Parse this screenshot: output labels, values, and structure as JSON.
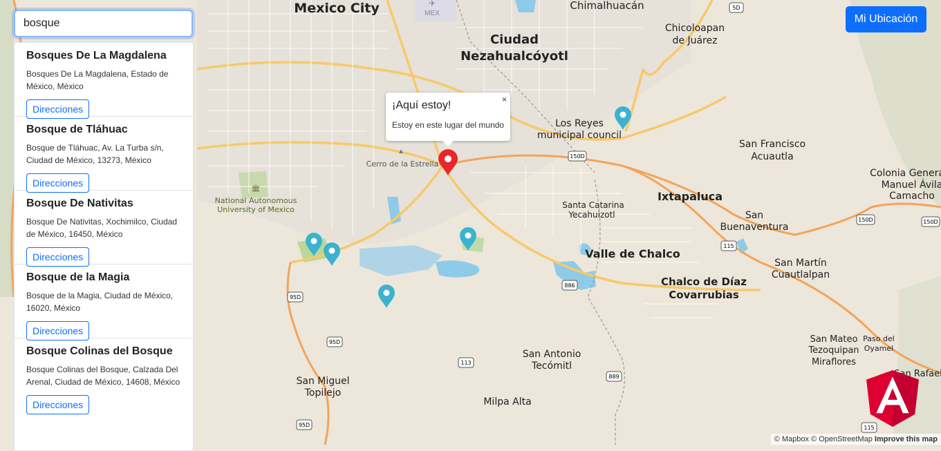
{
  "search": {
    "value": "bosque"
  },
  "results": [
    {
      "title": "Bosques De La Magdalena",
      "address_line1": "Bosques De La Magdalena, Estado de",
      "address_line2": "México, México",
      "button": "Direcciones"
    },
    {
      "title": "Bosque de Tláhuac",
      "address_line1": "Bosque de Tláhuac, Av. La Turba s/n,",
      "address_line2": "Ciudad de México, 13273, México",
      "button": "Direcciones"
    },
    {
      "title": "Bosque De Nativitas",
      "address_line1": "Bosque De Nativitas, Xochimilco, Ciudad",
      "address_line2": "de México, 16450, México",
      "button": "Direcciones"
    },
    {
      "title": "Bosque de la Magia",
      "address_line1": "Bosque de la Magia, Ciudad de México,",
      "address_line2": "16020, México",
      "button": "Direcciones"
    },
    {
      "title": "Bosque Colinas del Bosque",
      "address_line1": "Bosque Colinas del Bosque, Calzada Del",
      "address_line2": "Arenal, Ciudad de México, 14608, México",
      "button": "Direcciones"
    }
  ],
  "location_button": "Mi Ubicación",
  "popup": {
    "title": "¡Aquí estoy!",
    "text": "Estoy en este lugar del mundo",
    "close": "×"
  },
  "attribution": {
    "mapbox": "© Mapbox",
    "osm": "© OpenStreetMap",
    "improve": "Improve this map"
  },
  "map_labels": {
    "mexico_city": "Mexico City",
    "mex": "MEX",
    "chimalhuacan": "Chimalhuacán",
    "ciudad": "Ciudad",
    "nezahualcoyotl": "Nezahualcóyotl",
    "chicoloapan": "Chicoloapan",
    "de_juarez": "de Juárez",
    "los_reyes": "Los Reyes",
    "municipal_council": "municipal council",
    "san_francisco": "San Francisco",
    "acuautla": "Acuautla",
    "colonia_general": "Colonia General",
    "manuel_avila": "Manuel Ávila",
    "camacho": "Camacho",
    "cerro_estrella": "Cerro de la Estrella",
    "national_autonomous": "National Autonomous",
    "university_mexico": "University of Mexico",
    "santa_catarina": "Santa Catarina",
    "yecahuizotl": "Yecahuizotl",
    "ixtapaluca": "Ixtapaluca",
    "san": "San",
    "buenaventura": "Buenaventura",
    "valle_chalco": "Valle de Chalco",
    "san_martin": "San Martín",
    "cuautlalpan": "Cuautlalpan",
    "chalco_diaz": "Chalco de Díaz",
    "covarrubias": "Covarrubias",
    "san_antonio": "San Antonio",
    "tecomitl": "Tecómitl",
    "san_mateo": "San Mateo",
    "tezoquipan": "Tezoquipan",
    "miraflores": "Miraflores",
    "paso_del": "Paso del",
    "oyamel": "Oyamel",
    "san_rafael": "San Rafael",
    "san_miguel": "San Miguel",
    "topilejo": "Topilejo",
    "milpa_alta": "Milpa Alta",
    "shields": [
      "150D",
      "150D",
      "150D",
      "115",
      "886",
      "95D",
      "95D",
      "95D",
      "113",
      "889",
      "115",
      "5D"
    ]
  },
  "colors": {
    "primary": "#0d6efd",
    "marker_red": "#e8262b",
    "marker_teal": "#3bb2d0",
    "angular": "#dd0031"
  }
}
